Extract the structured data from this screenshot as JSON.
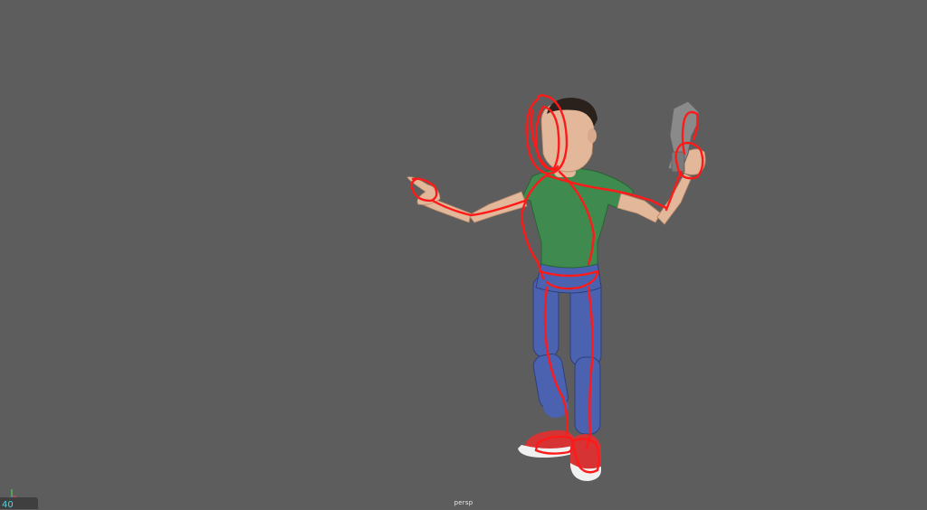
{
  "viewport": {
    "camera_label": "persp",
    "current_frame": "40"
  },
  "colors": {
    "background": "#5d5d5d",
    "shirt": "#3f8a4e",
    "pants": "#4a62b0",
    "skin": "#e2b79a",
    "hair": "#2a211c",
    "shoes": "#d63434",
    "sole": "#f0f0f0",
    "prop": "#8a8a8a",
    "annotation_stroke": "#ff1a1a",
    "frame_text": "#4fd3e0"
  },
  "icons": {
    "axis_gizmo": "xyz-axis-icon"
  }
}
